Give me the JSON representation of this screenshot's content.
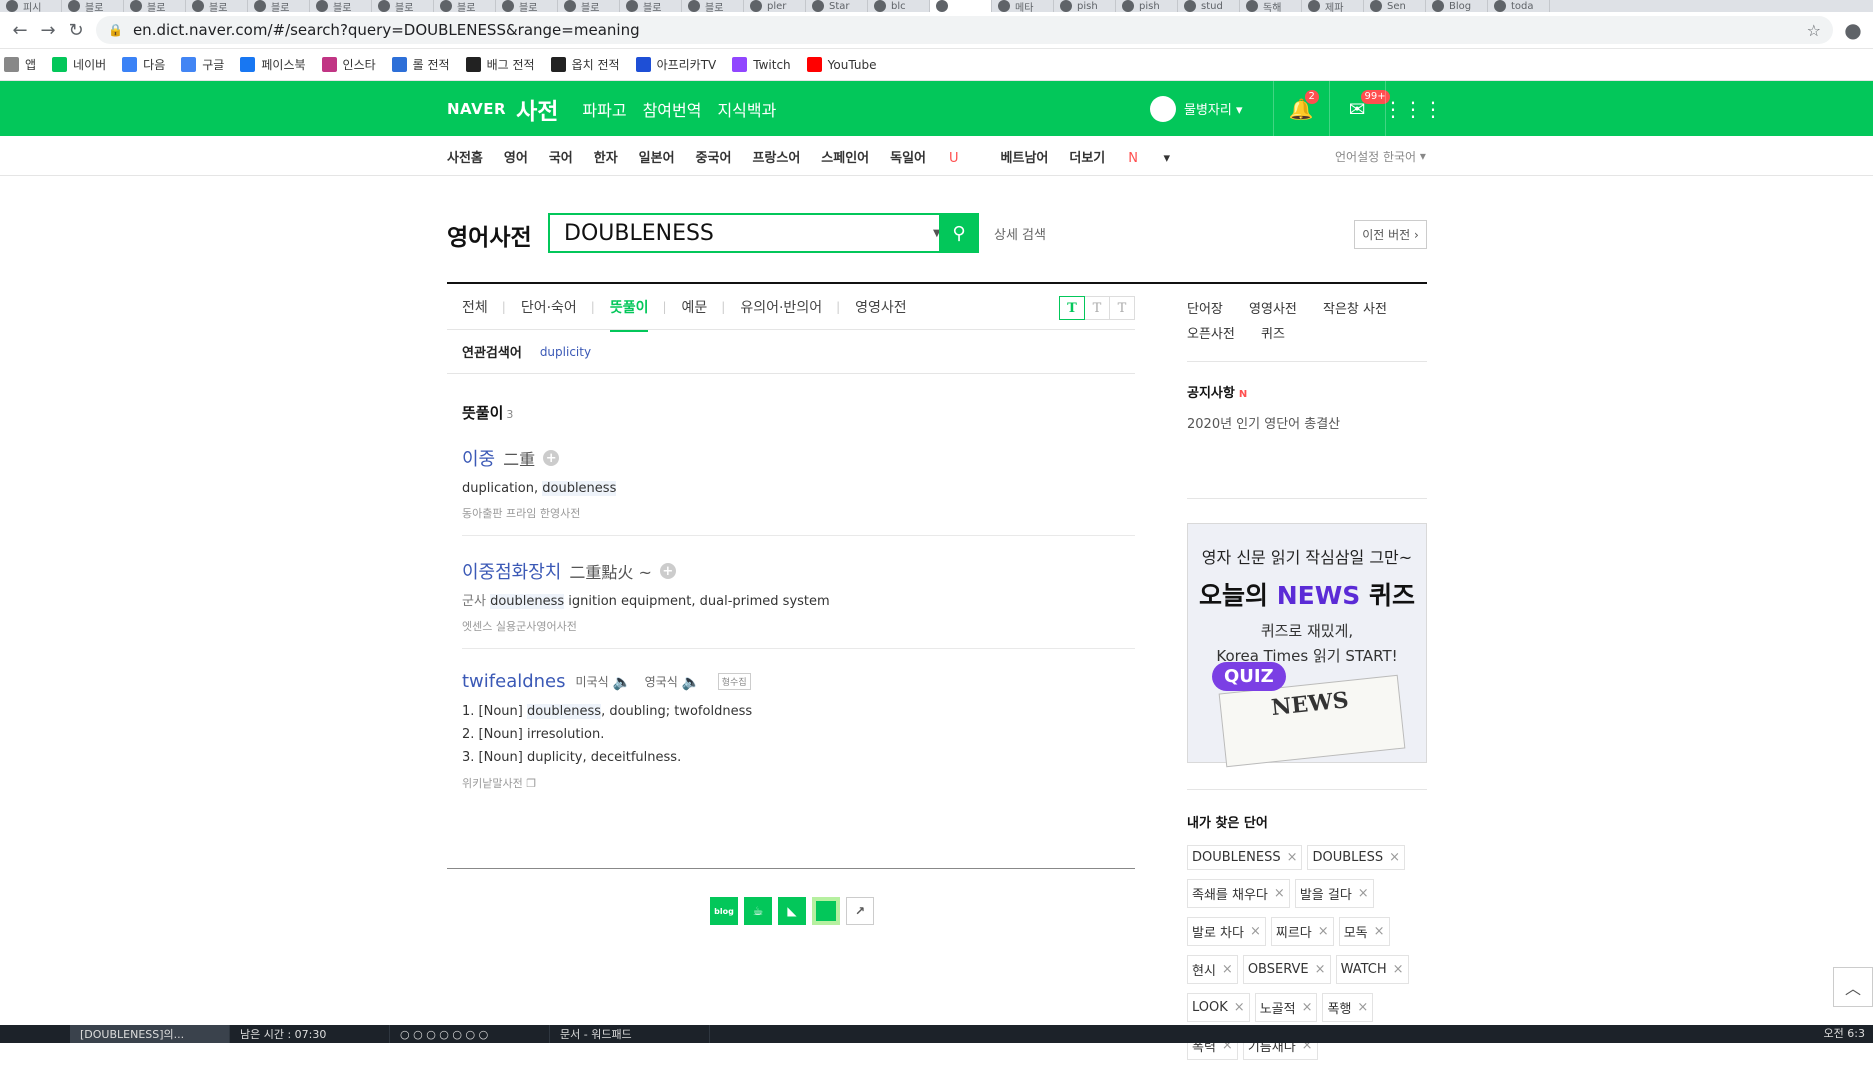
{
  "browser": {
    "tabs": [
      "피시",
      "블로",
      "블로",
      "블로",
      "블로",
      "블로",
      "블로",
      "블로",
      "블로",
      "블로",
      "블로",
      "블로",
      "pler",
      "Star",
      "blc",
      "",
      "메타",
      "pish",
      "pish",
      "stud",
      "독해",
      "제파",
      "Sen",
      "Blog",
      "toda"
    ],
    "active_tab_index": 15,
    "url": "en.dict.naver.com/#/search?query=DOUBLENESS&range=meaning",
    "bookmarks": [
      {
        "label": "앱",
        "icon": "apps-icon",
        "color": "#888888"
      },
      {
        "label": "네이버",
        "icon": "naver-icon",
        "color": "#03c75a"
      },
      {
        "label": "다음",
        "icon": "daum-icon",
        "color": "#3b82f6"
      },
      {
        "label": "구글",
        "icon": "google-icon",
        "color": "#4285f4"
      },
      {
        "label": "페이스북",
        "icon": "facebook-icon",
        "color": "#1877f2"
      },
      {
        "label": "인스타",
        "icon": "instagram-icon",
        "color": "#c13584"
      },
      {
        "label": "롤 전적",
        "icon": "opgg-icon",
        "color": "#2d6fd8"
      },
      {
        "label": "배그 전적",
        "icon": "pubg-icon",
        "color": "#222222"
      },
      {
        "label": "옵치 전적",
        "icon": "overwatch-icon",
        "color": "#222222"
      },
      {
        "label": "아프리카TV",
        "icon": "afreecatv-icon",
        "color": "#1e4fd6"
      },
      {
        "label": "Twitch",
        "icon": "twitch-icon",
        "color": "#9146ff"
      },
      {
        "label": "YouTube",
        "icon": "youtube-icon",
        "color": "#ff0000"
      }
    ]
  },
  "header": {
    "logo": "NAVER",
    "service": "사전",
    "links": [
      "파파고",
      "참여번역",
      "지식백과"
    ],
    "user": "물병자리",
    "notif_count": "2",
    "mail_count": "99+",
    "brand_color": "#03c75a"
  },
  "subnav": {
    "items": [
      "사전홈",
      "영어",
      "국어",
      "한자",
      "일본어",
      "중국어",
      "프랑스어",
      "스페인어",
      "독일어",
      "베트남어",
      "더보기"
    ],
    "german_mark": "U",
    "more_mark": "N",
    "language_setting": "언어설정 한국어"
  },
  "search": {
    "dict_title": "영어사전",
    "query": "DOUBLENESS",
    "advanced": "상세 검색",
    "prev_version": "이전 버전"
  },
  "tabs": {
    "items": [
      "전체",
      "단어·숙어",
      "뜻풀이",
      "예문",
      "유의어·반의어",
      "영영사전"
    ],
    "active": "뜻풀이",
    "font_sizes": [
      "T",
      "T",
      "T"
    ]
  },
  "related": {
    "label": "연관검색어",
    "value": "duplicity"
  },
  "results": {
    "section_title": "뜻풀이",
    "count": "3",
    "entries": [
      {
        "headword": "이중",
        "hanja": "二重",
        "meaning_pre": "duplication, ",
        "meaning_hl": "doubleness",
        "meaning_post": "",
        "source": "동아출판 프라임 한영사전"
      },
      {
        "headword": "이중점화장치",
        "hanja": "二重點火 ~",
        "meaning_pre": "군사 ",
        "meaning_hl": "doubleness",
        "meaning_post": " ignition equipment, dual-primed system",
        "source": "엣센스 실용군사영어사전"
      },
      {
        "headword": "twifealdnes",
        "pron_us": "미국식",
        "pron_uk": "영국식",
        "tag": "형수집",
        "senses": [
          {
            "pre": "1. [Noun] ",
            "hl": "doubleness",
            "post": ", doubling; twofoldness"
          },
          {
            "pre": "2. [Noun] irresolution.",
            "hl": "",
            "post": ""
          },
          {
            "pre": "3. [Noun] duplicity, deceitfulness.",
            "hl": "",
            "post": ""
          }
        ],
        "source": "위키낱말사전"
      }
    ]
  },
  "right": {
    "links": [
      "단어장",
      "영영사전",
      "작은창 사전",
      "오픈사전",
      "퀴즈"
    ],
    "notice_title": "공지사항",
    "notice_mark": "N",
    "notice_item": "2020년 인기 영단어 총결산",
    "ad": {
      "line1": "영자 신문 읽기 작심삼일 그만~",
      "line2_pre": "오늘의 ",
      "line2_news": "NEWS",
      "line2_post": " 퀴즈",
      "line3": "퀴즈로 재밌게,",
      "line4": "Korea Times 읽기 START!",
      "quiz": "QUIZ",
      "paper": "NEWS"
    },
    "history_title": "내가 찾은 단어",
    "history": [
      "DOUBLENESS",
      "DOUBLESS",
      "족쇄를 채우다",
      "발을 걸다",
      "발로 차다",
      "찌르다",
      "모독",
      "현시",
      "OBSERVE",
      "WATCH",
      "LOOK",
      "노골적",
      "폭행",
      "폭력",
      "기름채다"
    ]
  },
  "taskbar": {
    "items": [
      "[DOUBLENESS]의...",
      "남은 시간 : 07:30",
      "○ ○ ○ ○ ○ ○ ○",
      "문서 - 워드패드"
    ],
    "clock": "오전 6:3"
  }
}
